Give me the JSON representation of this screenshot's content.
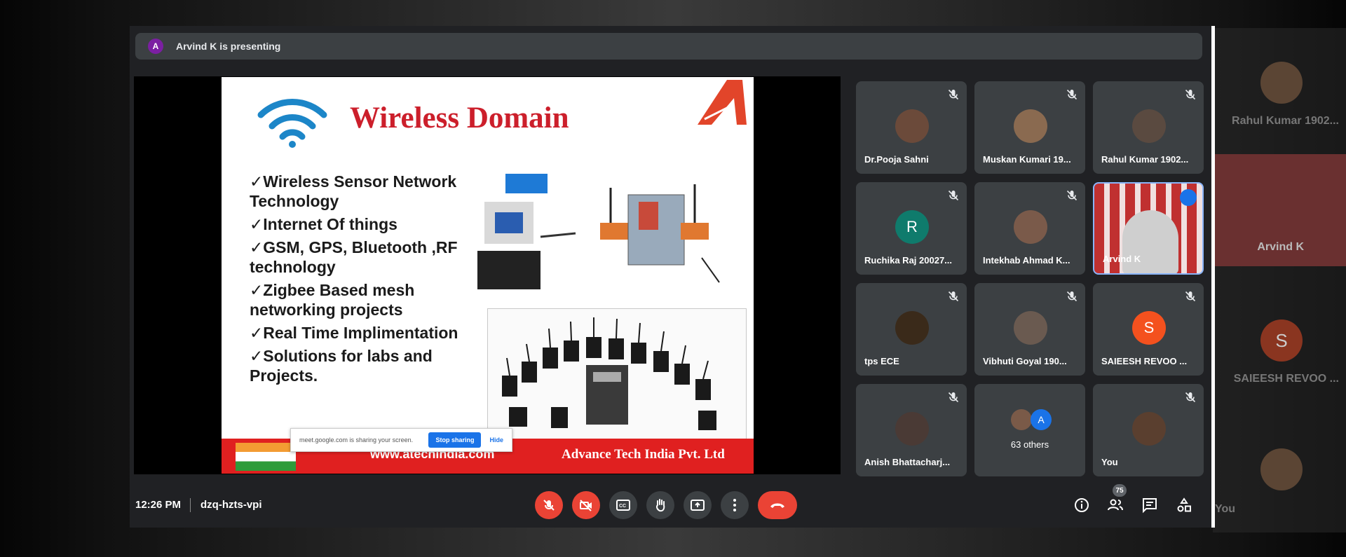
{
  "presenter": {
    "initial": "A",
    "text": "Arvind K is presenting"
  },
  "slide": {
    "title": "Wireless Domain",
    "bullets": [
      "Wireless Sensor Network Technology",
      "Internet Of things",
      "GSM, GPS, Bluetooth ,RF technology",
      "Zigbee Based mesh networking  projects",
      "Real Time Implimentation",
      "Solutions for labs  and Projects."
    ],
    "footer_url": "www.atechindia.com",
    "footer_company": "Advance Tech India Pvt. Ltd"
  },
  "share_banner": {
    "message": "meet.google.com is sharing your screen.",
    "stop": "Stop sharing",
    "hide": "Hide"
  },
  "participants": [
    {
      "name": "Dr.Pooja Sahni",
      "muted": true,
      "avatar_color": "#6b4a3a"
    },
    {
      "name": "Muskan Kumari 19...",
      "muted": true,
      "avatar_color": "#8a6a50"
    },
    {
      "name": "Rahul Kumar 1902...",
      "muted": true,
      "avatar_color": "#5a4a40"
    },
    {
      "name": "Ruchika Raj 20027...",
      "muted": true,
      "letter": "R",
      "avatar_color": "#0f7b6c"
    },
    {
      "name": "Intekhab Ahmad K...",
      "muted": true,
      "avatar_color": "#7a5a4a"
    },
    {
      "name": "Arvind K",
      "muted": false,
      "speaking": true
    },
    {
      "name": "tps ECE",
      "muted": true,
      "avatar_color": "#3a2a1a"
    },
    {
      "name": "Vibhuti Goyal 190...",
      "muted": true,
      "avatar_color": "#6a5a50"
    },
    {
      "name": "SAIEESH REVOO ...",
      "muted": true,
      "letter": "S",
      "avatar_color": "#f4511e"
    },
    {
      "name": "Anish Bhattacharj...",
      "muted": true,
      "avatar_color": "#4a3a35"
    },
    {
      "name": "63 others",
      "muted": false,
      "letter": "A",
      "avatar_color": "#1a73e8"
    },
    {
      "name": "You",
      "muted": true,
      "avatar_color": "#5a3f2f"
    }
  ],
  "meeting": {
    "time": "12:26 PM",
    "code": "dzq-hzts-vpi",
    "participant_count": "75"
  },
  "background": {
    "ghost_names": [
      "Rahul Kumar 1902...",
      "Arvind K",
      "SAIEESH REVOO ...",
      "You"
    ],
    "ghost_letter": "S"
  },
  "colors": {
    "end_call": "#ea4335",
    "control": "#3c4043",
    "accent": "#1a73e8",
    "slide_title": "#cc1f2b"
  }
}
